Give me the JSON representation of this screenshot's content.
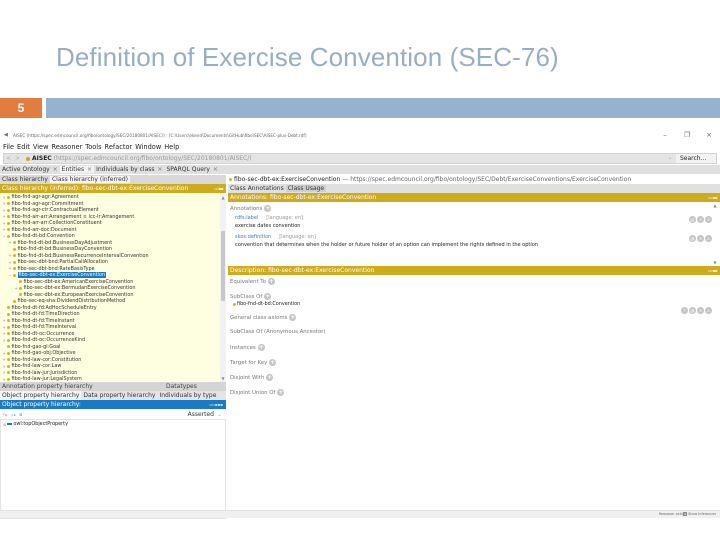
{
  "slide": {
    "title": "Definition of Exercise Convention (SEC-76)",
    "page_number": "5",
    "colors": {
      "title": "#98aec2",
      "page_badge": "#e07d3f",
      "band": "#95b3cf"
    }
  },
  "window": {
    "title": "AISEC (https://spec.edmcouncil.org/fibo/ontology/SEC/20180801/AISEC/) : [C:\\Users\\ekend\\Documents\\GitHub\\fibo\\SEC\\AISEC-plus-Debt.rdf]",
    "minimize": "–",
    "maximize": "❐",
    "close": "×"
  },
  "menu": [
    "File",
    "Edit",
    "View",
    "Reasoner",
    "Tools",
    "Refactor",
    "Window",
    "Help"
  ],
  "nav": {
    "back": "<",
    "forward": ">",
    "ontology_name": "AISEC",
    "ontology_iri": "(https://spec.edmcouncil.org/fibo/ontology/SEC/20180801/AISEC/)",
    "dropdown": "⌄",
    "search_label": "Search..."
  },
  "tabs": [
    {
      "label": "Active Ontology",
      "close": "×"
    },
    {
      "label": "Entities",
      "close": "×",
      "active": true
    },
    {
      "label": "Individuals by class",
      "close": "×"
    },
    {
      "label": "SPARQL Query",
      "close": "×"
    }
  ],
  "left": {
    "subtabs": [
      "Class hierarchy",
      "Class hierarchy (inferred)"
    ],
    "header": "Class hierarchy (inferred): fibo-sec-dbt-ex:ExerciseConvention",
    "header_controls": "▫▫▪▪",
    "tree": [
      {
        "label": "fibo-fnd-agr-agr:Agreement",
        "indent": 0,
        "expand": "+"
      },
      {
        "label": "fibo-fnd-agr-agr:Commitment",
        "indent": 0,
        "expand": "+"
      },
      {
        "label": "fibo-fnd-agr-ctr:ContractualElement",
        "indent": 0,
        "expand": "+"
      },
      {
        "label": "fibo-fnd-arr-arr:Arrangement ≡ lcc-lr:Arrangement",
        "indent": 0,
        "expand": "+"
      },
      {
        "label": "fibo-fnd-arr-arr:CollectionConstituent",
        "indent": 0,
        "expand": "+"
      },
      {
        "label": "fibo-fnd-arr-doc:Document",
        "indent": 0,
        "expand": "+"
      },
      {
        "label": "fibo-fnd-dt-bd:Convention",
        "indent": 0,
        "expand": "−"
      },
      {
        "label": "fibo-fnd-dt-bd:BusinessDayAdjustment",
        "indent": 1,
        "expand": "+"
      },
      {
        "label": "fibo-fnd-dt-bd:BusinessDayConvention",
        "indent": 1,
        "expand": ""
      },
      {
        "label": "fibo-fnd-dt-bd:BusinessRecurrenceIntervalConvention",
        "indent": 1,
        "expand": "+"
      },
      {
        "label": "fibo-sec-dbt-bnd:PartialCallAllocation",
        "indent": 1,
        "expand": "+"
      },
      {
        "label": "fibo-sec-dbt-bnd:RateBasisType",
        "indent": 1,
        "expand": "+"
      },
      {
        "label": "fibo-sec-dbt-ex:ExerciseConvention",
        "indent": 1,
        "expand": "−",
        "selected": true
      },
      {
        "label": "fibo-sec-dbt-ex:AmericanExerciseConvention",
        "indent": 2,
        "expand": ""
      },
      {
        "label": "fibo-sec-dbt-ex:BermudanExerciseConvention",
        "indent": 2,
        "expand": "+"
      },
      {
        "label": "fibo-sec-dbt-ex:EuropeanExerciseConvention",
        "indent": 2,
        "expand": ""
      },
      {
        "label": "fibo-sec-eq-sha:DividendDistributionMethod",
        "indent": 1,
        "expand": ""
      },
      {
        "label": "fibo-fnd-dt-fd:AdHocScheduleEntry",
        "indent": 0,
        "expand": ""
      },
      {
        "label": "fibo-fnd-dt-fd:TimeDirection",
        "indent": 0,
        "expand": ""
      },
      {
        "label": "fibo-fnd-dt-fd:TimeInstant",
        "indent": 0,
        "expand": "+"
      },
      {
        "label": "fibo-fnd-dt-fd:TimeInterval",
        "indent": 0,
        "expand": "+"
      },
      {
        "label": "fibo-fnd-dt-oc:Occurrence",
        "indent": 0,
        "expand": "+"
      },
      {
        "label": "fibo-fnd-dt-oc:OccurrenceKind",
        "indent": 0,
        "expand": "+"
      },
      {
        "label": "fibo-fnd-gao-gl:Goal",
        "indent": 0,
        "expand": ""
      },
      {
        "label": "fibo-fnd-gao-obj:Objective",
        "indent": 0,
        "expand": "+"
      },
      {
        "label": "fibo-fnd-law-cor:Constitution",
        "indent": 0,
        "expand": "+"
      },
      {
        "label": "fibo-fnd-law-cor:Law",
        "indent": 0,
        "expand": "+"
      },
      {
        "label": "fibo-fnd-law-jur:Jurisdiction",
        "indent": 0,
        "expand": "+"
      },
      {
        "label": "fibo-fnd-law-jur:LegalSystem",
        "indent": 0,
        "expand": "+"
      }
    ],
    "prop_tabs_row1": [
      "Annotation property hierarchy",
      "Datatypes"
    ],
    "prop_tabs_row2": [
      "Object property hierarchy",
      "Data property hierarchy",
      "Individuals by type"
    ],
    "prop_header": "Object property hierarchy:",
    "prop_header_controls": "▫▫▪▪▪",
    "prop_toolbar_icons": [
      "⊤▸",
      "⊥▸",
      "⊠"
    ],
    "asserted": "Asserted",
    "asserted_caret": "⌄",
    "prop_tree": [
      "owl:topObjectProperty"
    ]
  },
  "right": {
    "entity": "fibo-sec-dbt-ex:ExerciseConvention",
    "entity_iri": "— https://spec.edmcouncil.org/fibo/ontology/SEC/Debt/ExerciseConventions/ExerciseConvention",
    "subtabs": [
      "Class Annotations",
      "Class Usage"
    ],
    "annotations_header": "Annotations: fibo-sec-dbt-ex:ExerciseConvention",
    "annotations_label": "Annotations",
    "annotations": [
      {
        "property": "rdfs:label",
        "language": "[language: en]",
        "value": "exercise dates convention"
      },
      {
        "property": "skos:definition",
        "language": "[language: en]",
        "value": "convention that determines when the holder or future holder of an option can implement the rights defined in the option"
      }
    ],
    "description_header": "Description: fibo-sec-dbt-ex:ExerciseConvention",
    "header_controls": "▫▫▪▪",
    "sections": [
      {
        "label": "Equivalent To",
        "plus": true
      },
      {
        "label": "SubClass Of",
        "plus": true,
        "items": [
          "fibo-fnd-dt-bd:Convention"
        ]
      },
      {
        "label": "General class axioms",
        "plus": true
      },
      {
        "label": "SubClass Of (Anonymous Ancestor)",
        "plus": false
      },
      {
        "label": "Instances",
        "plus": true
      },
      {
        "label": "Target for Key",
        "plus": true
      },
      {
        "label": "Disjoint With",
        "plus": true
      },
      {
        "label": "Disjoint Union Of",
        "plus": true
      }
    ]
  },
  "status": {
    "reasoner": "Reasoner active",
    "show_inferences": "Show Inferences"
  },
  "colors": {
    "gold_header": "#ceab1c",
    "blue_header": "#1a7bc4",
    "tree_bg": "#fefee0"
  }
}
